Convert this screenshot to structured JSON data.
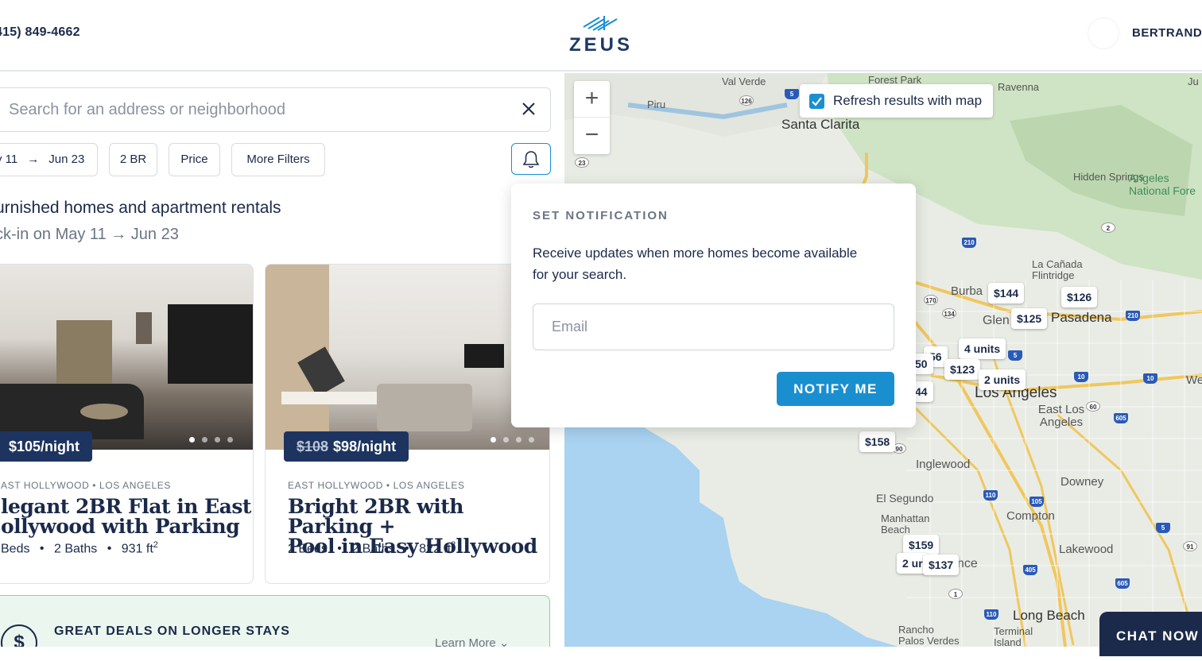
{
  "header": {
    "phone": "415) 849-4662",
    "logo_text": "ZEUS",
    "username": "BERTRAND"
  },
  "search": {
    "placeholder": "Search for an address or neighborhood",
    "value": "",
    "clear_icon": "close-icon"
  },
  "filters": {
    "date_start": "y 11",
    "date_arrow": "→",
    "date_end": "Jun 23",
    "beds": "2 BR",
    "price": "Price",
    "more": "More Filters",
    "notify_icon": "bell-icon"
  },
  "results": {
    "heading": "urnished homes and apartment rentals",
    "subheading": "ck-in on May 11 → Jun 23"
  },
  "listings": [
    {
      "price": "$105/night",
      "old_price": "",
      "location": "AST HOLLYWOOD  •  LOS ANGELES",
      "title_line1": "legant 2BR Flat in East",
      "title_line2": "ollywood with Parking",
      "beds": "Beds",
      "baths": "2 Baths",
      "area": "931 ft",
      "area_unit_sup": "2"
    },
    {
      "price": "$98/night",
      "old_price": "$108",
      "location": "EAST HOLLYWOOD  •  LOS ANGELES",
      "title_line1": "Bright 2BR with Parking +",
      "title_line2": "Pool in Easy Hollywood",
      "beds": "2 Beds",
      "baths": "2 Baths",
      "area": "822 ft",
      "area_unit_sup": "2"
    }
  ],
  "spec_separator": "•",
  "deal": {
    "icon_symbol": "$",
    "title": "GREAT DEALS ON LONGER STAYS",
    "link": "Learn More ⌄"
  },
  "map": {
    "zoom_in": "+",
    "zoom_out": "−",
    "refresh_label": "Refresh results with map",
    "refresh_checked": true,
    "places": [
      "Val Verde",
      "Forest Park",
      "Ravenna",
      "Piru",
      "Santa Clarita",
      "Hidden Springs",
      "Angeles National Fore",
      "La Cañada Flintridge",
      "Burba",
      "Glen",
      "Pasadena",
      "Los Angeles",
      "East Los Angeles",
      "Inglewood",
      "Downey",
      "El Segundo",
      "Manhattan Beach",
      "Compton",
      "Lakewood",
      "nce",
      "Long Beach",
      "Rancho Palos Verdes",
      "Terminal Island",
      "Wes",
      "Ju"
    ],
    "highways": [
      "5",
      "126",
      "23",
      "210",
      "2",
      "170",
      "134",
      "5",
      "210",
      "10",
      "10",
      "60",
      "605",
      "110",
      "105",
      "5",
      "405",
      "605",
      "91",
      "110",
      "1",
      "90"
    ],
    "pins": [
      "$144",
      "$126",
      "$125",
      "4 units",
      "56",
      "50",
      "$123",
      "2 units",
      "44",
      "$158",
      "$159",
      "2 ur",
      "$137"
    ]
  },
  "notification": {
    "title": "SET NOTIFICATION",
    "text": "Receive updates when more homes become available for your search.",
    "email_placeholder": "Email",
    "button": "NOTIFY ME"
  },
  "chat": {
    "label": "CHAT NOW"
  },
  "colors": {
    "navy": "#1b2a4a",
    "accent_blue": "#1a8fd0",
    "price_tag": "#1d3460",
    "deal_bg": "#eaf6ee"
  }
}
